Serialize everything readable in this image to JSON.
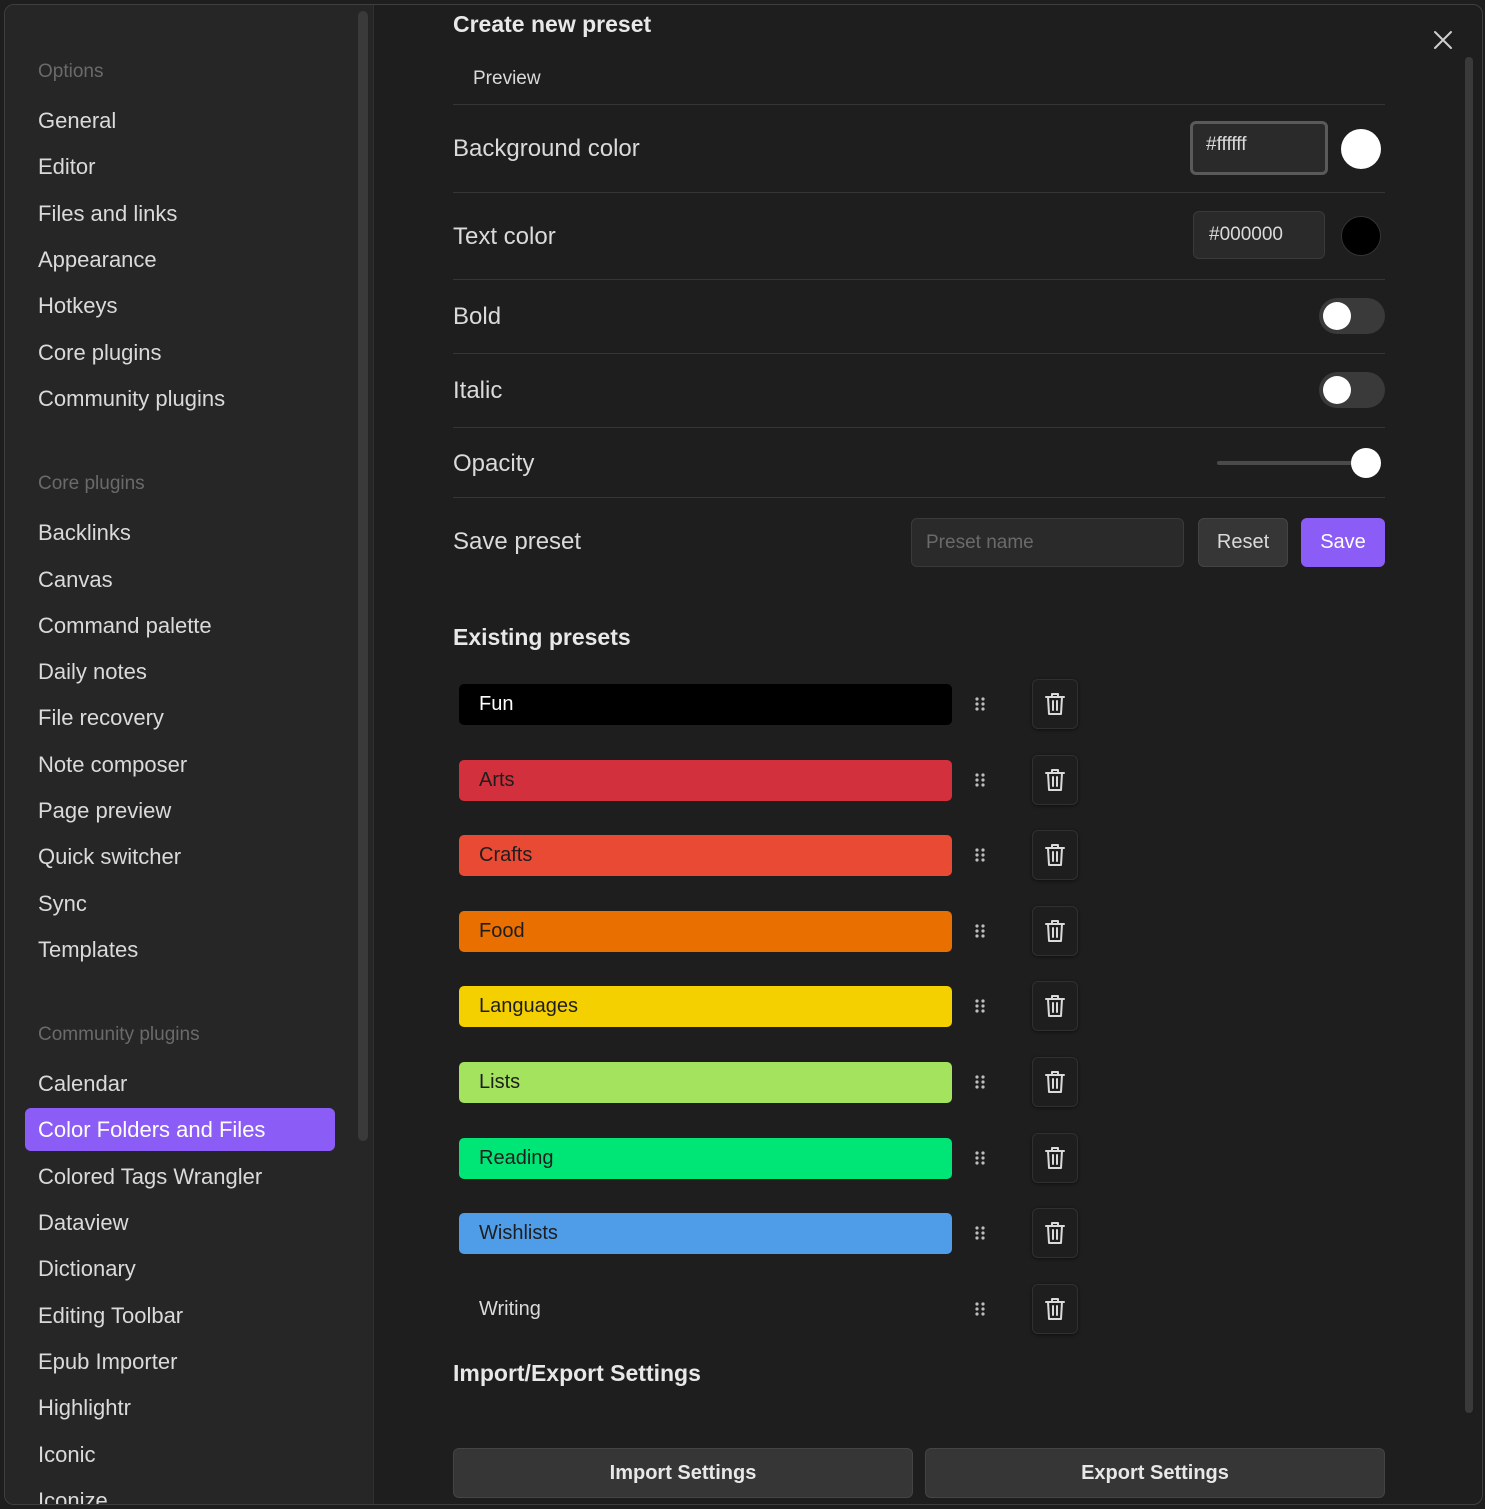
{
  "sidebar": {
    "options_header": "Options",
    "options": [
      "General",
      "Editor",
      "Files and links",
      "Appearance",
      "Hotkeys",
      "Core plugins",
      "Community plugins"
    ],
    "core_header": "Core plugins",
    "core": [
      "Backlinks",
      "Canvas",
      "Command palette",
      "Daily notes",
      "File recovery",
      "Note composer",
      "Page preview",
      "Quick switcher",
      "Sync",
      "Templates"
    ],
    "community_header": "Community plugins",
    "community": [
      "Calendar",
      "Color Folders and Files",
      "Colored Tags Wrangler",
      "Dataview",
      "Dictionary",
      "Editing Toolbar",
      "Epub Importer",
      "Highlightr",
      "Iconic",
      "Iconize"
    ],
    "active_item": "Color Folders and Files"
  },
  "create": {
    "title": "Create new preset",
    "preview": "Preview",
    "background_label": "Background color",
    "background_value": "#ffffff",
    "text_label": "Text color",
    "text_value": "#000000",
    "bold_label": "Bold",
    "bold_on": false,
    "italic_label": "Italic",
    "italic_on": false,
    "opacity_label": "Opacity",
    "opacity_value": 1.0,
    "save_label": "Save preset",
    "preset_placeholder": "Preset name",
    "reset_button": "Reset",
    "save_button": "Save"
  },
  "existing": {
    "title": "Existing presets",
    "presets": [
      {
        "name": "Fun",
        "bg": "#000000",
        "fg": "#ffffff"
      },
      {
        "name": "Arts",
        "bg": "#d1303c",
        "fg": "#1e1e1e"
      },
      {
        "name": "Crafts",
        "bg": "#e84a34",
        "fg": "#1e1e1e"
      },
      {
        "name": "Food",
        "bg": "#e86f00",
        "fg": "#1e1e1e"
      },
      {
        "name": "Languages",
        "bg": "#f5d000",
        "fg": "#1e1e1e"
      },
      {
        "name": "Lists",
        "bg": "#a3e35e",
        "fg": "#1e1e1e"
      },
      {
        "name": "Reading",
        "bg": "#00e676",
        "fg": "#1e1e1e"
      },
      {
        "name": "Wishlists",
        "bg": "#4f9de8",
        "fg": "#1e1e1e"
      },
      {
        "name": "Writing",
        "bg": "transparent",
        "fg": "#dadada"
      }
    ]
  },
  "import_export": {
    "title": "Import/Export Settings",
    "import_button": "Import Settings",
    "export_button": "Export Settings"
  },
  "colors": {
    "accent": "#8b5cf6"
  }
}
